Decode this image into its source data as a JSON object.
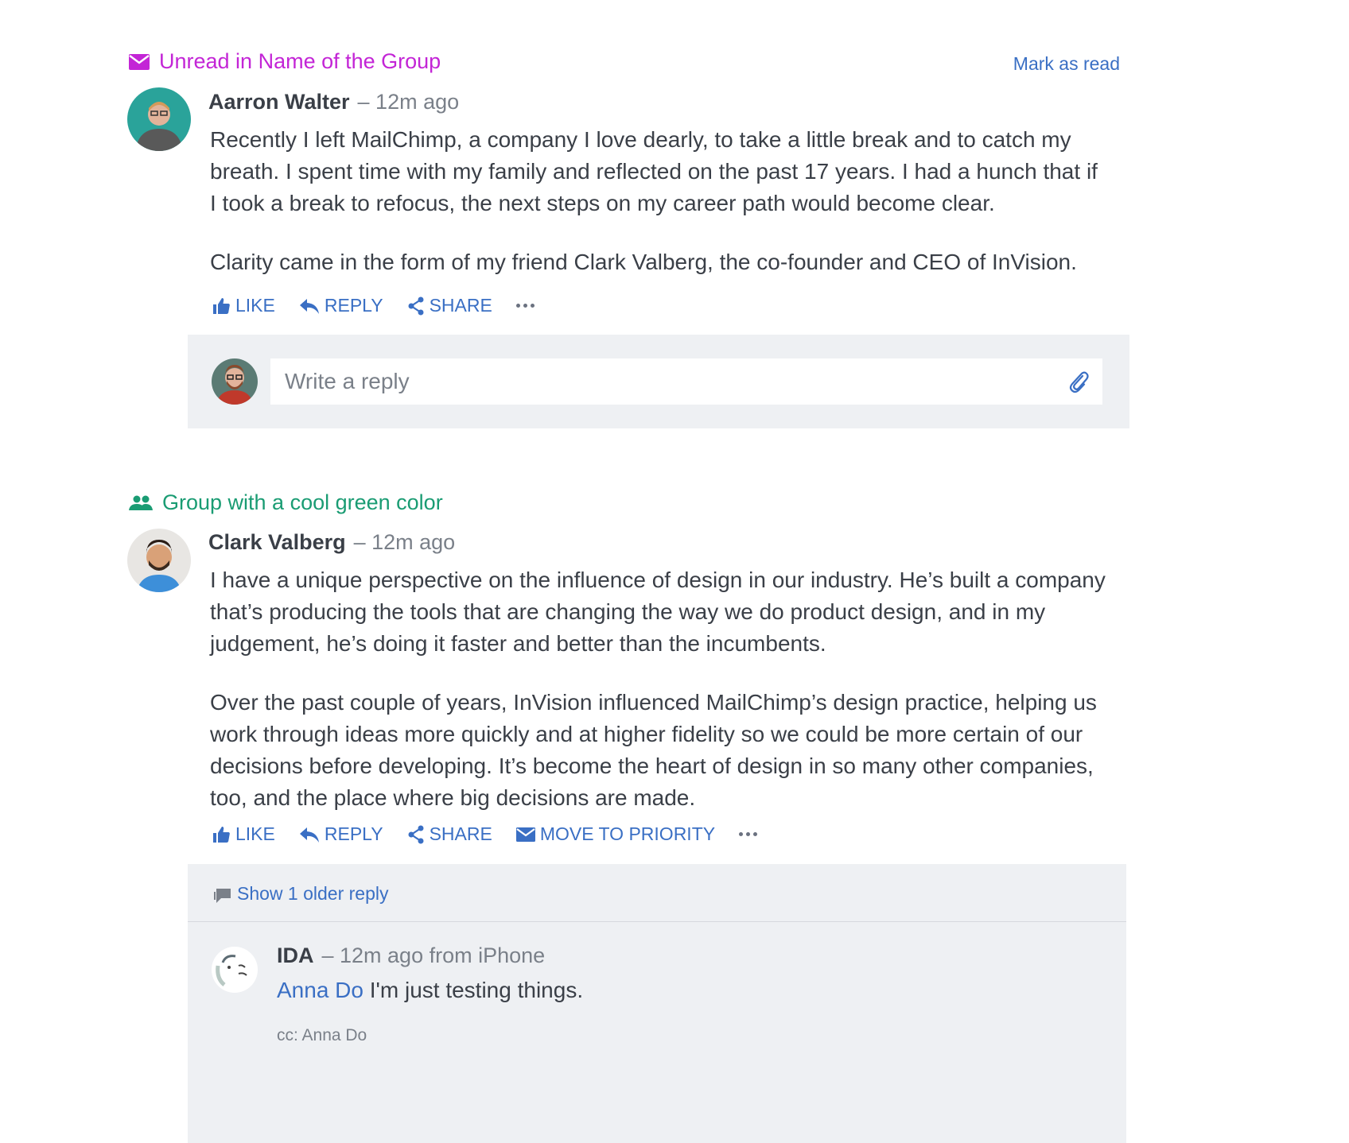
{
  "thread1": {
    "group_name": "Unread in Name of the Group",
    "group_color": "#c325d6",
    "mark_as_read": "Mark as read",
    "author": "Aarron Walter",
    "meta": "– 12m ago",
    "paragraphs": [
      "Recently I left MailChimp, a company I love dearly, to take a little break and to catch my breath. I spent time with my family and reflected on the past 17 years. I had a hunch that if I took a break to refocus, the next steps on my career path would become clear.",
      "Clarity came in the form of my friend Clark Valberg, the co-founder and CEO of InVision."
    ],
    "actions": {
      "like": "LIKE",
      "reply": "REPLY",
      "share": "SHARE"
    },
    "reply_placeholder": "Write a reply"
  },
  "thread2": {
    "group_name": "Group with a cool green color",
    "group_color": "#1a9c73",
    "author": "Clark Valberg",
    "meta": "– 12m ago",
    "paragraphs": [
      "I have a unique perspective on the influence of design in our industry. He’s built a company that’s producing the tools that are changing the way we do product design, and in my judgement, he’s doing it faster and better than the incumbents.",
      "Over the past couple of years, InVision influenced MailChimp’s design practice, helping us work through ideas more quickly and at higher fidelity so we could be more certain of our decisions before developing. It’s become the heart of design in so many other companies, too, and the place where big decisions are made."
    ],
    "actions": {
      "like": "LIKE",
      "reply": "REPLY",
      "share": "SHARE",
      "move_to_priority": "MOVE TO PRIORITY"
    },
    "show_older": "Show 1 older reply",
    "reply": {
      "author": "IDA",
      "meta": "– 12m ago from iPhone",
      "mention": "Anna Do",
      "text": " I'm just testing things.",
      "cc": "cc: Anna Do"
    }
  },
  "colors": {
    "link": "#3a6fc4",
    "panel": "#eef0f3"
  },
  "icons": [
    "envelope-icon",
    "group-icon",
    "thumbs-up-icon",
    "reply-arrow-icon",
    "share-icon",
    "more-dots-icon",
    "paperclip-icon",
    "comment-icon"
  ]
}
